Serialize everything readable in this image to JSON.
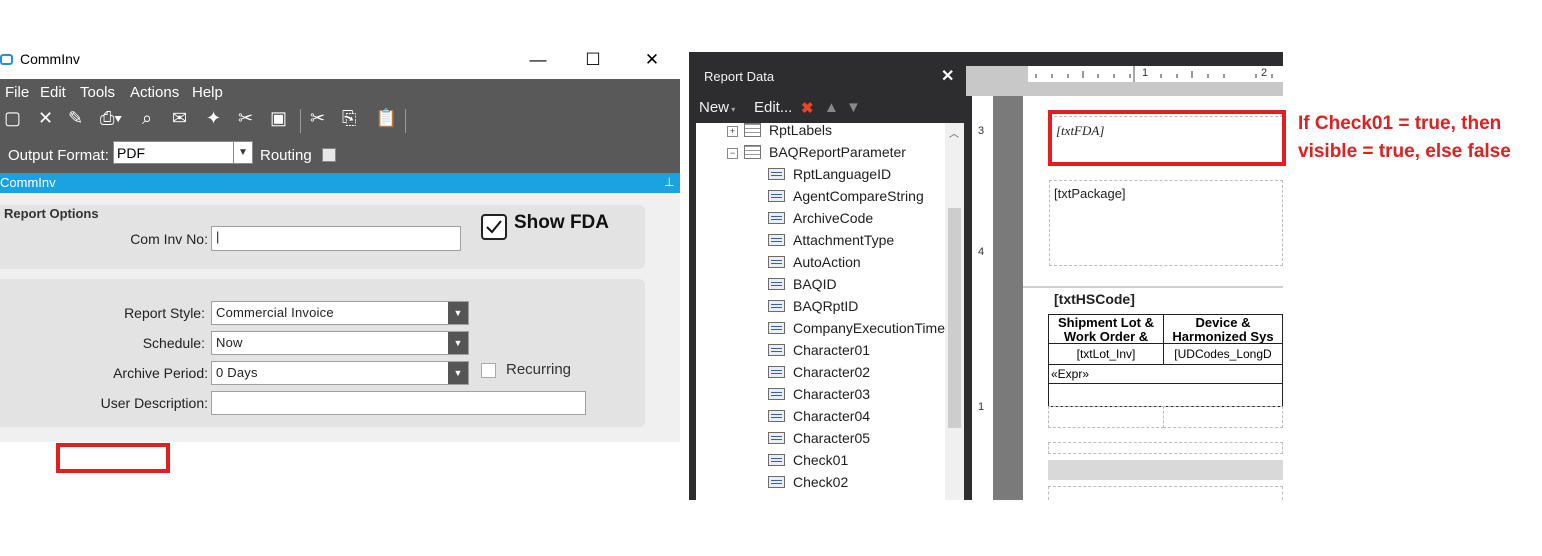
{
  "left_window": {
    "title": "CommInv",
    "window_buttons": {
      "minimize": "—",
      "maximize": "☐",
      "close": "✕"
    },
    "menu": [
      "File",
      "Edit",
      "Tools",
      "Actions",
      "Help"
    ],
    "output_format_label": "Output Format:",
    "output_format_value": "PDF",
    "routing_label": "Routing",
    "panel_title": "CommInv",
    "report_options_label": "Report Options",
    "com_inv_no_label": "Com Inv No:",
    "com_inv_no_value": "",
    "show_fda_label": "Show FDA",
    "show_fda_checked": true,
    "report_style_label": "Report Style:",
    "report_style_value": "Commercial Invoice",
    "schedule_label": "Schedule:",
    "schedule_value": "Now",
    "archive_period_label": "Archive Period:",
    "archive_period_value": "0 Days",
    "recurring_label": "Recurring",
    "user_description_label": "User Description:",
    "user_description_value": ""
  },
  "report_data": {
    "title": "Report Data",
    "toolbar": {
      "new": "New",
      "edit": "Edit..."
    },
    "tree": [
      {
        "label": "RptLabels",
        "kind": "table",
        "expander": "+"
      },
      {
        "label": "BAQReportParameter",
        "kind": "table",
        "expander": "−"
      },
      {
        "label": "RptLanguageID",
        "kind": "field"
      },
      {
        "label": "AgentCompareString",
        "kind": "field"
      },
      {
        "label": "ArchiveCode",
        "kind": "field"
      },
      {
        "label": "AttachmentType",
        "kind": "field"
      },
      {
        "label": "AutoAction",
        "kind": "field"
      },
      {
        "label": "BAQID",
        "kind": "field"
      },
      {
        "label": "BAQRptID",
        "kind": "field"
      },
      {
        "label": "CompanyExecutionTime",
        "kind": "field"
      },
      {
        "label": "Character01",
        "kind": "field"
      },
      {
        "label": "Character02",
        "kind": "field"
      },
      {
        "label": "Character03",
        "kind": "field"
      },
      {
        "label": "Character04",
        "kind": "field"
      },
      {
        "label": "Character05",
        "kind": "field"
      },
      {
        "label": "Check01",
        "kind": "field"
      },
      {
        "label": "Check02",
        "kind": "field"
      }
    ]
  },
  "designer": {
    "ruler_top_numbers": [
      "1",
      "2"
    ],
    "ruler_left_numbers": [
      "3",
      "4",
      "1"
    ],
    "txt_fda": "[txtFDA]",
    "txt_package": "[txtPackage]",
    "txt_hscode": "[txtHSCode]",
    "table_headers": [
      "Shipment Lot & Work Order &",
      "Device & Harmonized Sys"
    ],
    "table_row": [
      "[txtLot_Inv]",
      "[UDCodes_LongD"
    ],
    "expr_row": "«Expr»"
  },
  "annotation": "If Check01 = true, then visible = true, else false",
  "colors": {
    "menubar": "#595959",
    "panelbar": "#1aa3e0",
    "highlight": "#e02020",
    "vs_dark": "#2d2d30"
  }
}
